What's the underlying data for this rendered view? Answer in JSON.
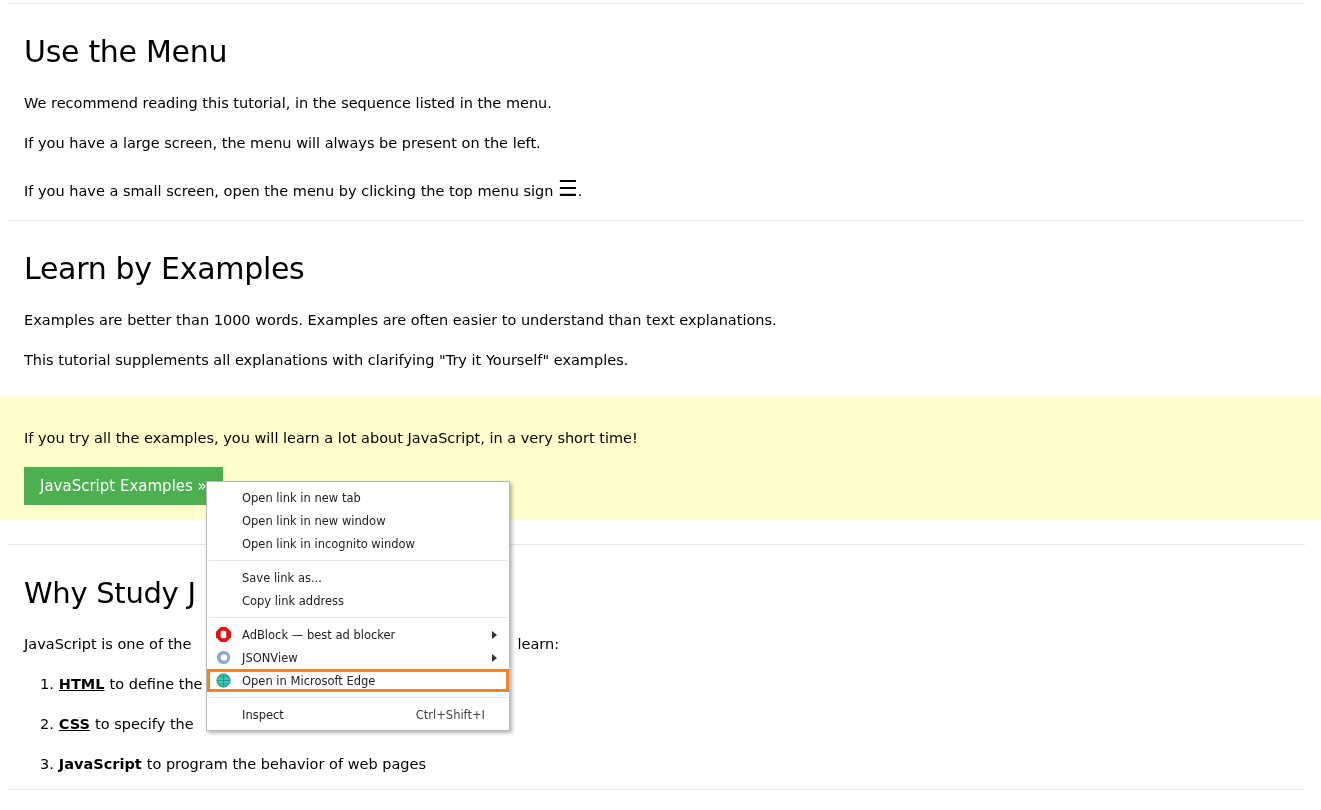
{
  "sections": [
    {
      "heading": "Use the Menu",
      "paragraphs": [
        {
          "text": "We recommend reading this tutorial, in the sequence listed in the menu."
        },
        {
          "text": "If you have a large screen, the menu will always be present on the left."
        },
        {
          "text": "If you have a small screen, open the menu by clicking the top menu sign",
          "sign": "☰",
          "after": "."
        }
      ]
    },
    {
      "heading": "Learn by Examples",
      "paragraphs": [
        {
          "text": "Examples are better than 1000 words. Examples are often easier to understand than text explanations."
        },
        {
          "text": "This tutorial supplements all explanations with clarifying \"Try it Yourself\" examples."
        }
      ]
    }
  ],
  "note": {
    "text": "If you try all the examples, you will learn a lot about JavaScript, in a very short time!",
    "button": "JavaScript Examples »"
  },
  "why": {
    "heading": "Why Study J",
    "intro": "JavaScript is one of the",
    "intro_end": "learn:",
    "items": [
      {
        "number": "1.",
        "term": "HTML",
        "link": true,
        "text": "to define the"
      },
      {
        "number": "2.",
        "term": "CSS",
        "link": true,
        "text": "to specify the"
      },
      {
        "number": "3.",
        "term": "JavaScript",
        "link": false,
        "text": "to program the behavior of web pages"
      }
    ]
  },
  "context_menu": {
    "groups": [
      [
        {
          "label": "Open link in new tab",
          "submenu": false,
          "selected": false
        },
        {
          "label": "Open link in new window",
          "submenu": false,
          "selected": false
        },
        {
          "label": "Open link in incognito window",
          "submenu": false,
          "selected": false
        }
      ],
      [
        {
          "label": "Save link as...",
          "submenu": false,
          "selected": false
        },
        {
          "label": "Copy link address",
          "submenu": false,
          "selected": false
        }
      ],
      [
        {
          "label": "AdBlock — best ad blocker",
          "kind": "adblock",
          "submenu": true,
          "selected": false
        },
        {
          "label": "JSONView",
          "kind": "jsonview",
          "submenu": true,
          "selected": false
        },
        {
          "label": "Open in Microsoft Edge",
          "kind": "globe",
          "submenu": false,
          "selected": true
        }
      ],
      [
        {
          "label": "Inspect",
          "shortcut": "Ctrl+Shift+I",
          "submenu": false,
          "selected": false
        }
      ]
    ]
  }
}
